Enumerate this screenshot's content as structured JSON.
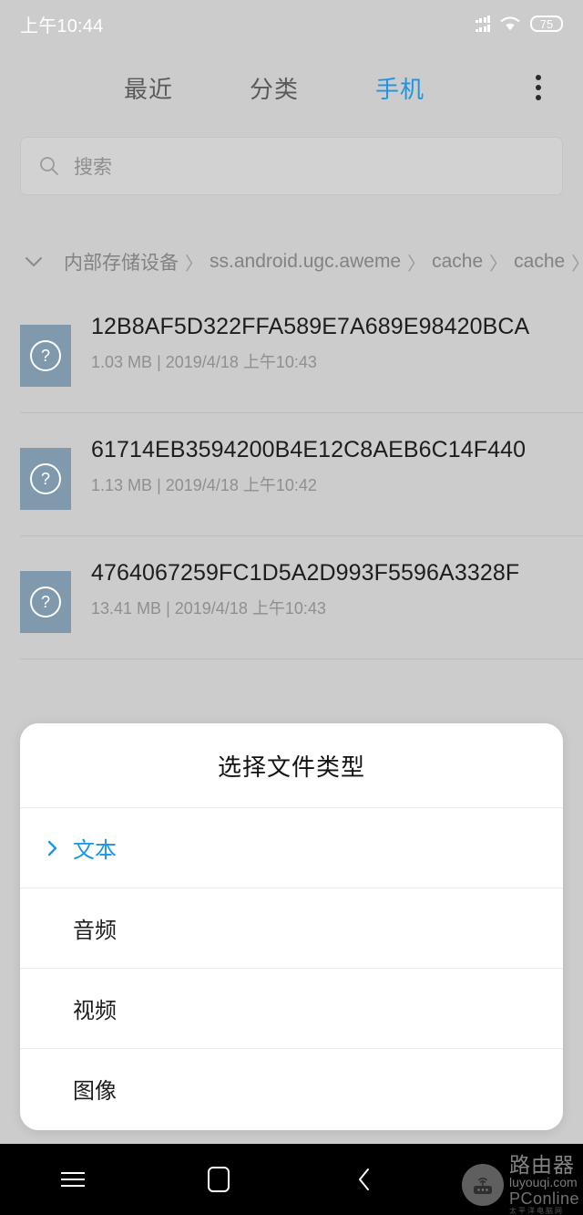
{
  "status_bar": {
    "time": "上午10:44",
    "battery_level": "75",
    "signal_icon": "signal-bars-icon",
    "wifi_icon": "wifi-icon"
  },
  "tab_bar": {
    "tabs": [
      {
        "label": "最近",
        "active": false
      },
      {
        "label": "分类",
        "active": false
      },
      {
        "label": "手机",
        "active": true
      }
    ],
    "overflow_icon": "more-vertical-icon"
  },
  "search": {
    "placeholder": "搜索",
    "value": "",
    "icon": "search-icon"
  },
  "breadcrumb": {
    "toggle_icon": "chevron-down-icon",
    "separator": "〉",
    "crumbs": [
      "内部存储设备",
      "ss.android.ugc.aweme",
      "cache",
      "cache"
    ]
  },
  "file_list": {
    "files": [
      {
        "name": "12B8AF5D322FFA589E7A689E98420BCA",
        "size": "1.03 MB",
        "separator": "|",
        "date": "2019/4/18 上午10:43",
        "icon": "unknown-file-icon",
        "icon_glyph": "?"
      },
      {
        "name": "61714EB3594200B4E12C8AEB6C14F440",
        "size": "1.13 MB",
        "separator": "|",
        "date": "2019/4/18 上午10:42",
        "icon": "unknown-file-icon",
        "icon_glyph": "?"
      },
      {
        "name": "4764067259FC1D5A2D993F5596A3328F",
        "size": "13.41 MB",
        "separator": "|",
        "date": "2019/4/18 上午10:43",
        "icon": "unknown-file-icon",
        "icon_glyph": "?"
      }
    ]
  },
  "dialog": {
    "title": "选择文件类型",
    "options": [
      {
        "label": "文本",
        "selected": true,
        "icon": "chevron-right-icon"
      },
      {
        "label": "音频",
        "selected": false,
        "icon": ""
      },
      {
        "label": "视频",
        "selected": false,
        "icon": ""
      },
      {
        "label": "图像",
        "selected": false,
        "icon": ""
      }
    ]
  },
  "nav_bar": {
    "menu_icon": "menu-icon",
    "home_icon": "home-icon",
    "back_icon": "chevron-left-icon"
  },
  "watermark": {
    "logo_icon": "router-icon",
    "name": "路由器",
    "url": "luyouqi.com",
    "brand": "PConline",
    "tagline": "太平洋电脑网"
  },
  "colors": {
    "accent_blue": "#1a96e8",
    "page_background": "#cccccc",
    "dialog_background": "#ffffff",
    "file_icon": "#8099ad",
    "nav_bar": "#000000"
  }
}
